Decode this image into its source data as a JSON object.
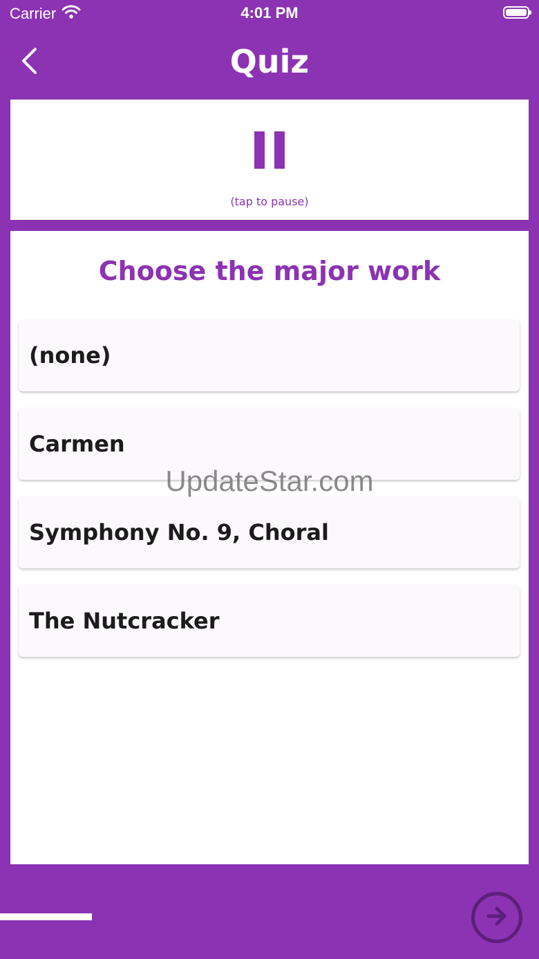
{
  "status_bar": {
    "carrier": "Carrier",
    "time": "4:01 PM"
  },
  "nav": {
    "title": "Quiz",
    "back_icon": "chevron-left-icon"
  },
  "pause": {
    "icon": "pause-icon",
    "hint": "(tap to pause)"
  },
  "question": {
    "prompt": "Choose the major work",
    "answers": [
      "(none)",
      "Carmen",
      "Symphony No. 9, Choral",
      "The Nutcracker"
    ]
  },
  "watermark": "UpdateStar.com",
  "progress": {
    "fraction": 0.17
  },
  "next": {
    "icon": "arrow-right-circle-icon"
  },
  "colors": {
    "accent": "#8b33b2",
    "card": "#ffffff",
    "answer_bg": "#fbf9fc",
    "next_button": "#5c1f7a"
  }
}
